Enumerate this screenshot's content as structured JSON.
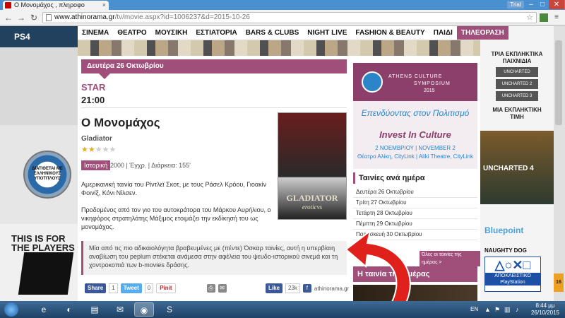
{
  "browser": {
    "tab_title": "Ο Μονομάχος , πληροφο",
    "tab_close": "×",
    "user_label": "Trial",
    "min": "–",
    "max": "□",
    "close": "✕",
    "back": "←",
    "forward": "→",
    "reload": "↻",
    "url_host": "www.athinorama.gr",
    "url_path": "/tv/movie.aspx?id=1006237&d=2015-10-26",
    "star": "☆",
    "menu": "≡"
  },
  "nav": {
    "items": [
      "ΣΙΝΕΜΑ",
      "ΘΕΑΤΡΟ",
      "ΜΟΥΣΙΚΗ",
      "ΕΣΤΙΑΤΟΡΙΑ",
      "BARS & CLUBS",
      "NIGHT LIVE",
      "FASHION & BEAUTY",
      "ΠΑΙΔΙ",
      "ΤΗΛΕΟΡΑΣΗ"
    ],
    "active_index": 8
  },
  "left_ad": {
    "brand": "PS4",
    "badge": "ΔΙΑΤΙΘΕΤΑΙ ΜΕ ΕΛΛΗΝΙΚΟΥΣ ΥΠΟΤΙΤΛΟΥΣ",
    "line1": "THIS IS FOR",
    "line2": "THE PLAYERS"
  },
  "right_ad": {
    "head": "ΤΡΙΑ ΕΚΠΛΗΚΤΙΚΑ ΠΑΙΧΝΙΔΙΑ",
    "games": [
      "UNCHARTED",
      "UNCHARTED 2",
      "UNCHARTED 3"
    ],
    "price1": "ΜΙΑ ΕΚΠΛΗΚΤΙΚΗ",
    "price2": "ΤΙΜΗ",
    "uncharted": "UNCHARTED 4",
    "studio1": "Bluepoint",
    "studio2": "NAUGHTY DOG",
    "ps_symbols": "△○✕□",
    "ps_tag": "ΑΠΟΚΛΕΙΣΤΙΚΟ PlayStation",
    "pegi": "16"
  },
  "program": {
    "date": "Δευτέρα 26 Οκτωβρίου",
    "channel": "STAR",
    "time": "21:00"
  },
  "movie": {
    "title": "Ο Μονομάχος",
    "original_title": "Gladiator",
    "rating": 2,
    "rating_max": 5,
    "genre": "Ιστορική",
    "meta": "2000 | Έγχρ. | Διάρκεια: 155'",
    "desc1": "Αμερικανική ταινία του Ρίντλεϊ Σκοτ, με τους Ράσελ Κρόου, Γιοακίν Φοινίξ, Κόνι Νίλσεν.",
    "desc2": "Προδομένος από τον γιο του αυτοκράτορα του Μάρκου Αυρήλιου, ο νικηφόρος στρατηλάτης Μάξιμος ετοιμάζει την εκδίκησή του ως μονομάχος.",
    "quote": "Μία από τις πιο αδικαιολόγητα βραβευμένες με (πέντε) Όσκαρ ταινίες, αυτή η υπερβίαιη αναβίωση του peplum στέκεται ανάμεσα στην αφέλεια του ψευδο-ιστορικού σινεμά και τη χοντροκοπιά των b-movies δράσης.",
    "poster_title": "GLADIATOR",
    "poster_sub": "eroticvs"
  },
  "share": {
    "fb": "Share",
    "fb_count": "1",
    "tw": "Tweet",
    "tw_count": "0",
    "pin": "Pinit",
    "like": "Like",
    "like_count": "23k",
    "page": "athinorama.gr"
  },
  "sidebar": {
    "banner1": "ATHENS CULTURE",
    "banner2": "SYMPOSIUM",
    "banner3": "2015",
    "banner4": "Επενδύοντας στον Πολιτισμό",
    "banner5": "Invest In Culture",
    "banner6": "2 ΝΟΕΜΒΡΙΟΥ | NOVEMBER 2",
    "banner7": "Θέατρο Αλίκη, CityLink | Aliki Theatre, CityLink",
    "head": "Ταινίες ανά ημέρα",
    "days": [
      "Δευτέρα 26 Οκτωβρίου",
      "Τρίτη 27 Οκτωβρίου",
      "Τετάρτη 28 Οκτωβρίου",
      "Πέμπτη 29 Οκτωβρίου",
      "Παρασκευή 30 Οκτωβρίου"
    ],
    "all": "Όλες οι ταινίες της ημέρας >",
    "movie_day": "Η ταινία της ημέρας"
  },
  "taskbar": {
    "lang": "EN",
    "time": "8:44 μμ",
    "date": "26/10/2015"
  }
}
